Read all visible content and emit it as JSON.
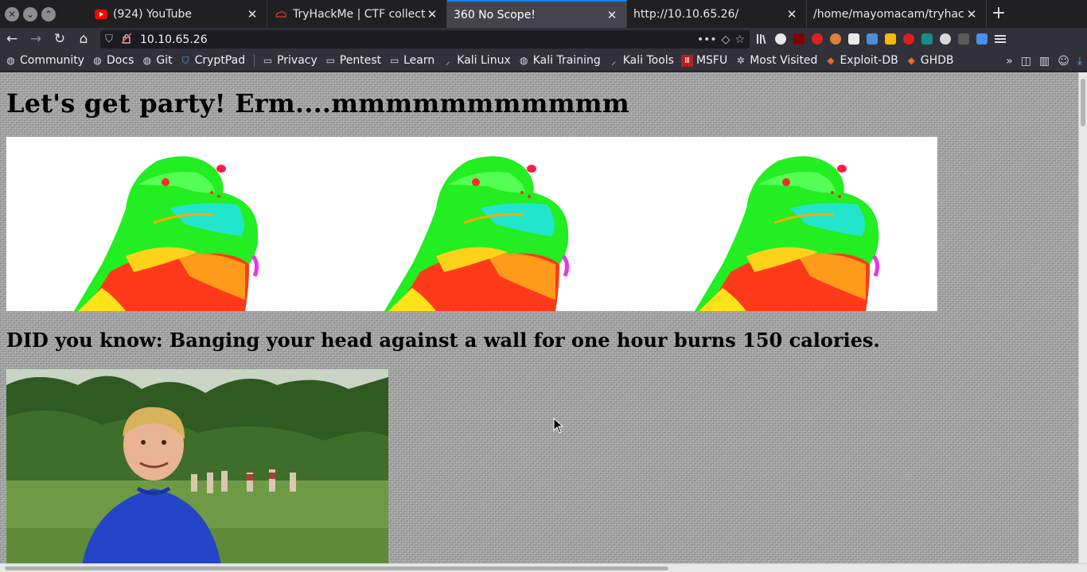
{
  "window_controls": {
    "close": "✕",
    "minimize": "⌄",
    "maximize": "⌃"
  },
  "tabs": [
    {
      "title": "(924) YouTube",
      "icon": "youtube-icon",
      "active": false
    },
    {
      "title": "TryHackMe | CTF collecti",
      "icon": "tryhackme-icon",
      "active": false
    },
    {
      "title": "360 No Scope!",
      "icon": "",
      "active": true
    },
    {
      "title": "http://10.10.65.26/",
      "icon": "",
      "active": false
    },
    {
      "title": "/home/mayomacam/tryhack",
      "icon": "",
      "active": false
    }
  ],
  "tab_close": "✕",
  "new_tab": "+",
  "nav": {
    "back": "←",
    "forward": "→",
    "reload": "↻",
    "home": "⌂"
  },
  "url": "10.10.65.26",
  "url_actions": {
    "more": "•••",
    "pocket": "◇",
    "bookmark": "☆"
  },
  "extensions": [
    "library-icon",
    "ninja-icon",
    "ublock-icon",
    "stop-icon",
    "cookie-icon",
    "grid-icon",
    "bird-icon",
    "terminal-icon",
    "red-s-icon",
    "n-icon",
    "gear-icon",
    "ut-icon",
    "translate-icon",
    "menu-icon"
  ],
  "bookmarks": [
    {
      "label": "Community",
      "icon": "globe-icon"
    },
    {
      "label": "Docs",
      "icon": "globe-icon"
    },
    {
      "label": "Git",
      "icon": "globe-icon"
    },
    {
      "label": "CryptPad",
      "icon": "shield-icon"
    },
    {
      "label": "Privacy",
      "icon": "folder-icon"
    },
    {
      "label": "Pentest",
      "icon": "folder-icon"
    },
    {
      "label": "Learn",
      "icon": "folder-icon"
    },
    {
      "label": "Kali Linux",
      "icon": "kali-icon"
    },
    {
      "label": "Kali Training",
      "icon": "globe-icon"
    },
    {
      "label": "Kali Tools",
      "icon": "kali-icon"
    },
    {
      "label": "MSFU",
      "icon": "msfu-icon"
    },
    {
      "label": "Most Visited",
      "icon": "gear-icon"
    },
    {
      "label": "Exploit-DB",
      "icon": "exploitdb-icon"
    },
    {
      "label": "GHDB",
      "icon": "exploitdb-icon"
    }
  ],
  "bookmarks_more": "»",
  "page": {
    "heading": "Let's get party! Erm....mmmmmmmmmmm",
    "fact": "DID you know: Banging your head against a wall for one hour burns 150 calories."
  },
  "colors": {
    "accent": "#0a84ff",
    "youtube": "#ff0000",
    "tryhackme": "#c0392b"
  }
}
